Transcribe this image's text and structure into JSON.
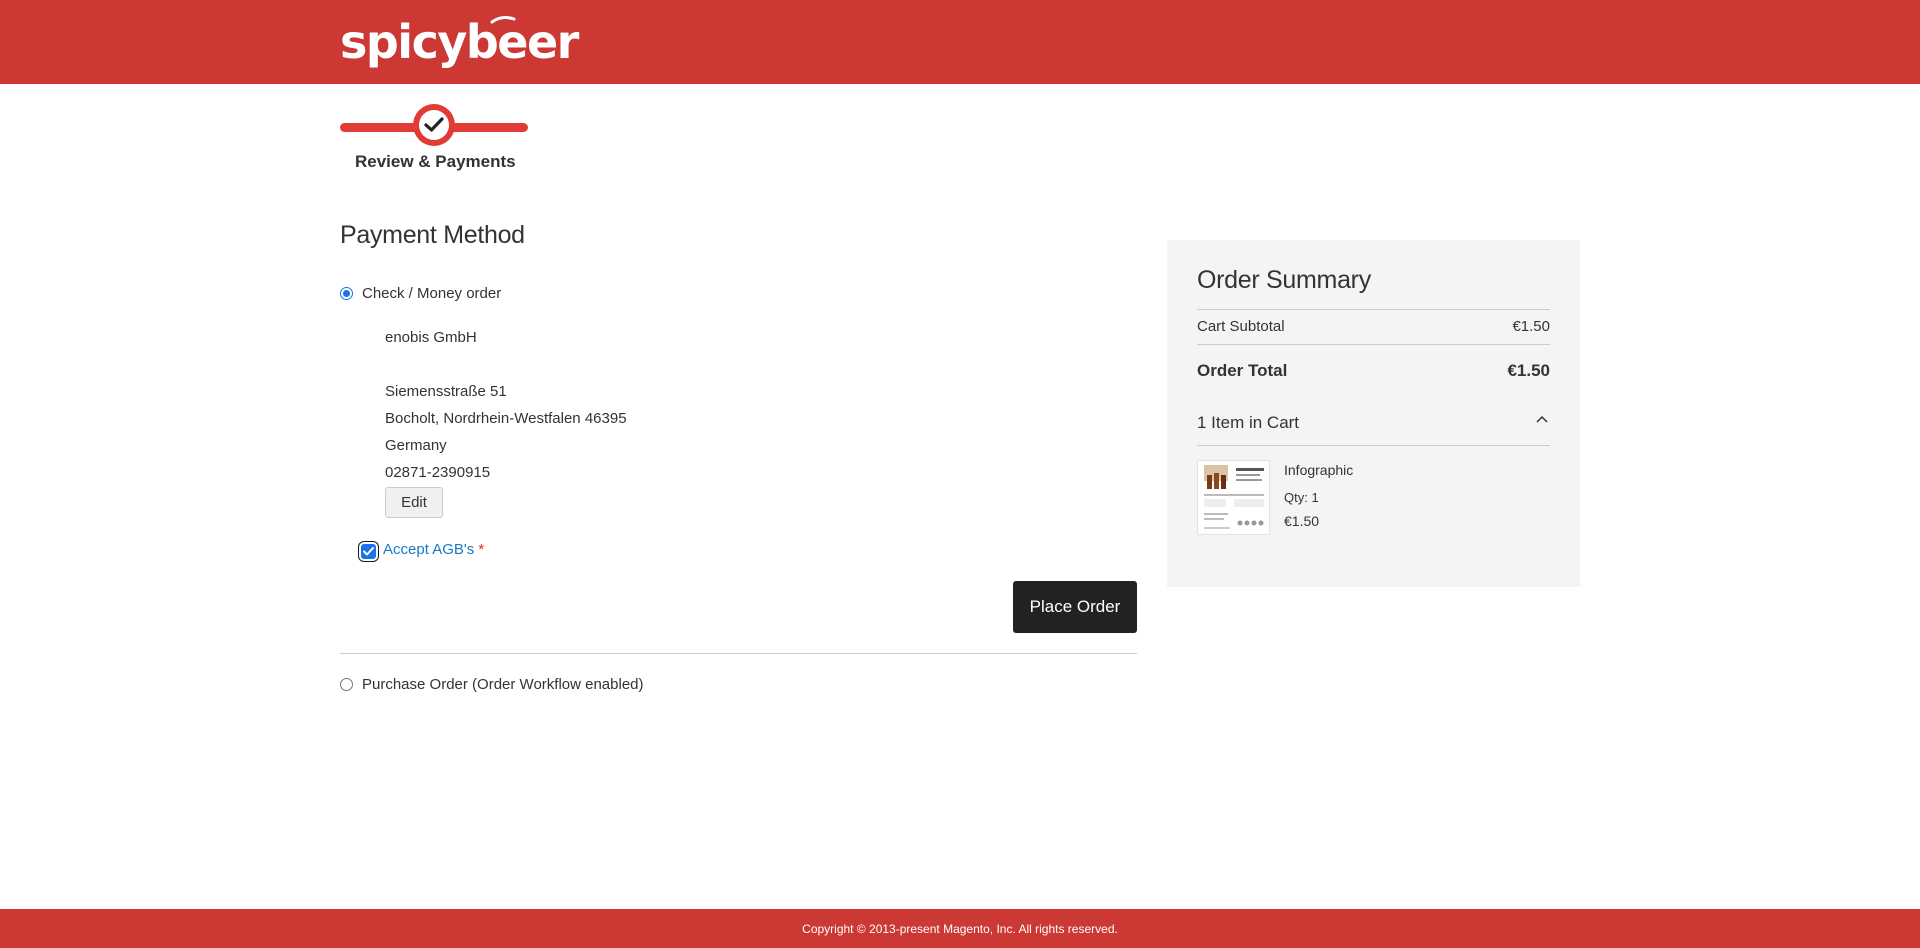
{
  "header": {
    "logo_text": "spicybeer",
    "brand_color": "#cc3834"
  },
  "progress": {
    "step_label": "Review & Payments",
    "icon": "checkmark-icon"
  },
  "payment": {
    "title": "Payment Method",
    "methods": [
      {
        "label": "Check / Money order",
        "selected": true
      },
      {
        "label": "Purchase Order (Order Workflow enabled)",
        "selected": false
      }
    ],
    "address": {
      "company": "enobis GmbH",
      "street": "Siemensstraße 51",
      "city_line": "Bocholt, Nordrhein-Westfalen 46395",
      "country": "Germany",
      "phone": "02871-2390915"
    },
    "edit_label": "Edit",
    "agreement_label": "Accept AGB's",
    "agreement_required_mark": "*",
    "agreement_checked": true,
    "place_order_label": "Place Order"
  },
  "summary": {
    "title": "Order Summary",
    "subtotal_label": "Cart Subtotal",
    "subtotal_value": "€1.50",
    "total_label": "Order Total",
    "total_value": "€1.50",
    "items_header": "1 Item in Cart",
    "items": [
      {
        "name": "Infographic",
        "qty": "Qty: 1",
        "price": "€1.50"
      }
    ]
  },
  "footer": {
    "copyright": "Copyright © 2013-present Magento, Inc. All rights reserved."
  }
}
